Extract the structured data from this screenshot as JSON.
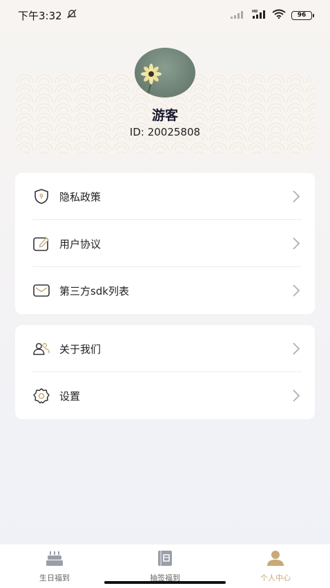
{
  "status": {
    "time": "下午3:32",
    "battery": "96",
    "network": "HD"
  },
  "profile": {
    "name": "游客",
    "id_text": "ID: 20025808"
  },
  "menu_group_1": [
    {
      "label": "隐私政策",
      "icon": "shield-icon"
    },
    {
      "label": "用户协议",
      "icon": "edit-document-icon"
    },
    {
      "label": "第三方sdk列表",
      "icon": "mail-icon"
    }
  ],
  "menu_group_2": [
    {
      "label": "关于我们",
      "icon": "users-icon"
    },
    {
      "label": "设置",
      "icon": "gear-icon"
    }
  ],
  "tabs": [
    {
      "label": "生日福到",
      "icon": "cake-icon",
      "active": false
    },
    {
      "label": "抽签福到",
      "icon": "book-icon",
      "active": false
    },
    {
      "label": "个人中心",
      "icon": "person-icon",
      "active": true
    }
  ],
  "colors": {
    "accent": "#c8a97a",
    "icon_stroke": "#333333",
    "chevron": "#b0b0b0"
  }
}
